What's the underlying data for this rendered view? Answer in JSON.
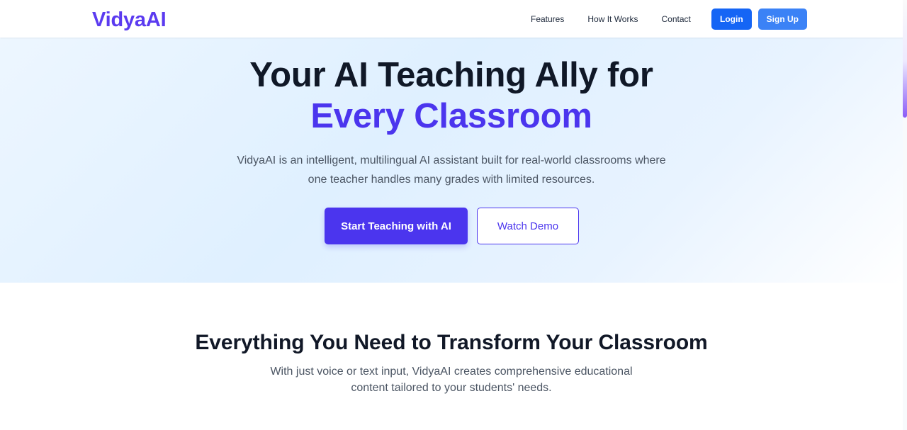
{
  "brand": {
    "name": "VidyaAI"
  },
  "nav": {
    "features": "Features",
    "how_it_works": "How It Works",
    "contact": "Contact",
    "login": "Login",
    "signup": "Sign Up"
  },
  "hero": {
    "title_line_1": "Your AI Teaching Ally for",
    "title_line_2": "Every Classroom",
    "description_line_1": "VidyaAI is an intelligent, multilingual AI assistant built for real-world classrooms where",
    "description_line_2": "one teacher handles many grades with limited resources.",
    "primary_cta": "Start Teaching with AI",
    "secondary_cta": "Watch Demo"
  },
  "features": {
    "title": "Everything You Need to Transform Your Classroom",
    "description_line_1": "With just voice or text input, VidyaAI creates comprehensive educational",
    "description_line_2": "content tailored to your students' needs."
  },
  "colors": {
    "brand": "#5b3bf0",
    "primary": "#4b35ee",
    "login": "#1565f5",
    "signup": "#3b82f6",
    "heading": "#101827",
    "body_text": "#4b5563"
  }
}
